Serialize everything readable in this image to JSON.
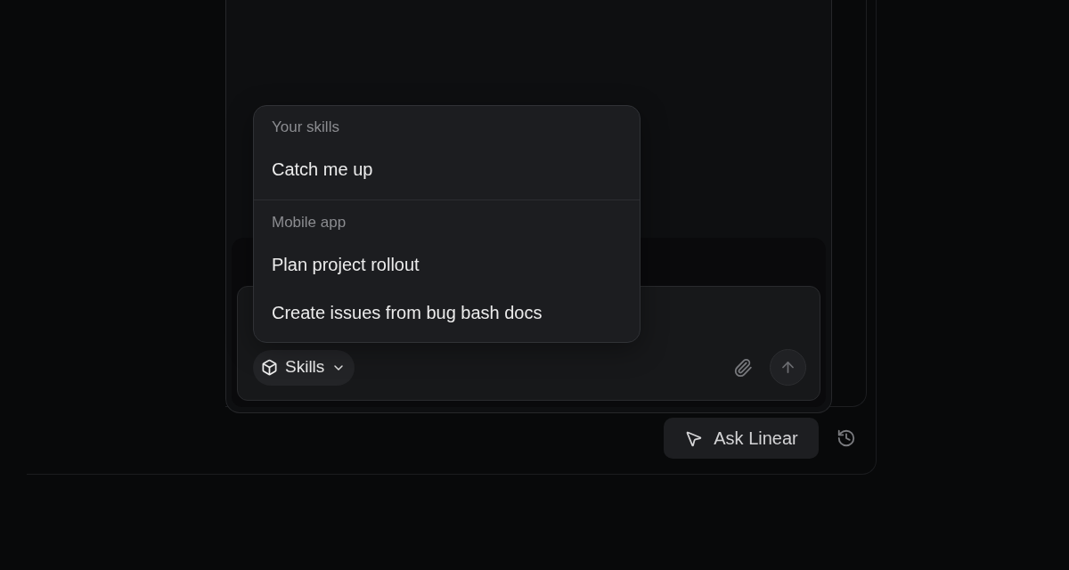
{
  "popover": {
    "sections": [
      {
        "heading": "Your skills",
        "items": [
          {
            "label": "Catch me up"
          }
        ]
      },
      {
        "heading": "Mobile app",
        "items": [
          {
            "label": "Plan project rollout"
          },
          {
            "label": "Create issues from bug bash docs"
          }
        ]
      }
    ]
  },
  "composer": {
    "skills_button": {
      "label": "Skills"
    }
  },
  "ask_button": {
    "label": "Ask Linear"
  }
}
